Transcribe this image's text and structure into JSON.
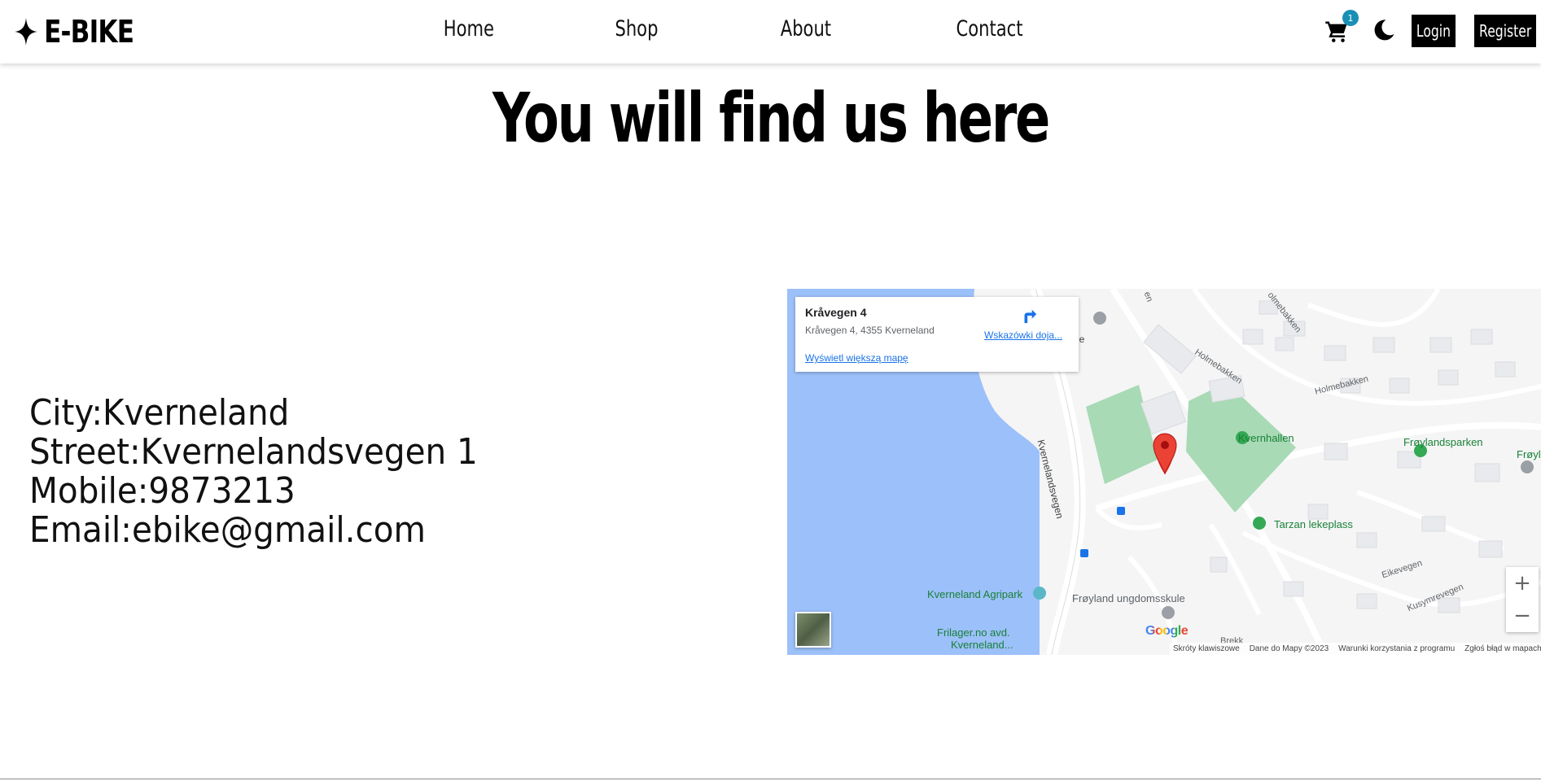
{
  "brand": {
    "name": "E-BIKE",
    "icon": "sparkle-icon"
  },
  "nav": {
    "links": [
      {
        "label": "Home"
      },
      {
        "label": "Shop"
      },
      {
        "label": "About"
      },
      {
        "label": "Contact"
      }
    ]
  },
  "header_actions": {
    "cart_count": "1",
    "cart_icon": "cart-icon",
    "theme_icon": "moon-icon",
    "login_label": "Login",
    "register_label": "Register"
  },
  "page": {
    "heading": "You will find us here"
  },
  "contact": {
    "city": "City:Kverneland",
    "street": "Street:Kvernelandsvegen 1",
    "mobile": "Mobile:9873213",
    "email": "Email:ebike@gmail.com"
  },
  "map": {
    "place_title": "Kråvegen 4",
    "place_address": "Kråvegen 4, 4355 Kverneland",
    "directions_label": "Wskazówki doja...",
    "larger_map_link": "Wyświetl większą mapę",
    "zoom_in": "+",
    "zoom_out": "−",
    "google_logo": "Google",
    "labels": {
      "kvernhallen": "Kvernhallen",
      "froylandsparken": "Frøylandsparken",
      "froyla": "Frøyla",
      "tarzan": "Tarzan lekeplass",
      "agripark": "Kverneland Agripark",
      "ungdomsskule": "Frøyland ungdomsskule",
      "frilager1": "Frilager.no avd.",
      "frilager2": "Kverneland...",
      "kvernelandsvegen": "Kvernelandsvegen",
      "holmebakken1": "Holmebakken",
      "holmebakken2": "Holmebakken",
      "olmebakken": "olmebakken",
      "eikevegen": "Eikevegen",
      "kusymrevegen": "Kusymrevegen",
      "brekk": "Brekk",
      "le": "le",
      "en": "en"
    },
    "attribution": {
      "shortcuts": "Skróty klawiszowe",
      "data": "Dane do Mapy ©2023",
      "terms": "Warunki korzystania z programu",
      "report": "Zgłoś błąd w mapach"
    },
    "colors": {
      "water": "#9cc0f9",
      "park": "#a8dab5",
      "land": "#f5f5f5",
      "pin": "#ea4335"
    }
  }
}
